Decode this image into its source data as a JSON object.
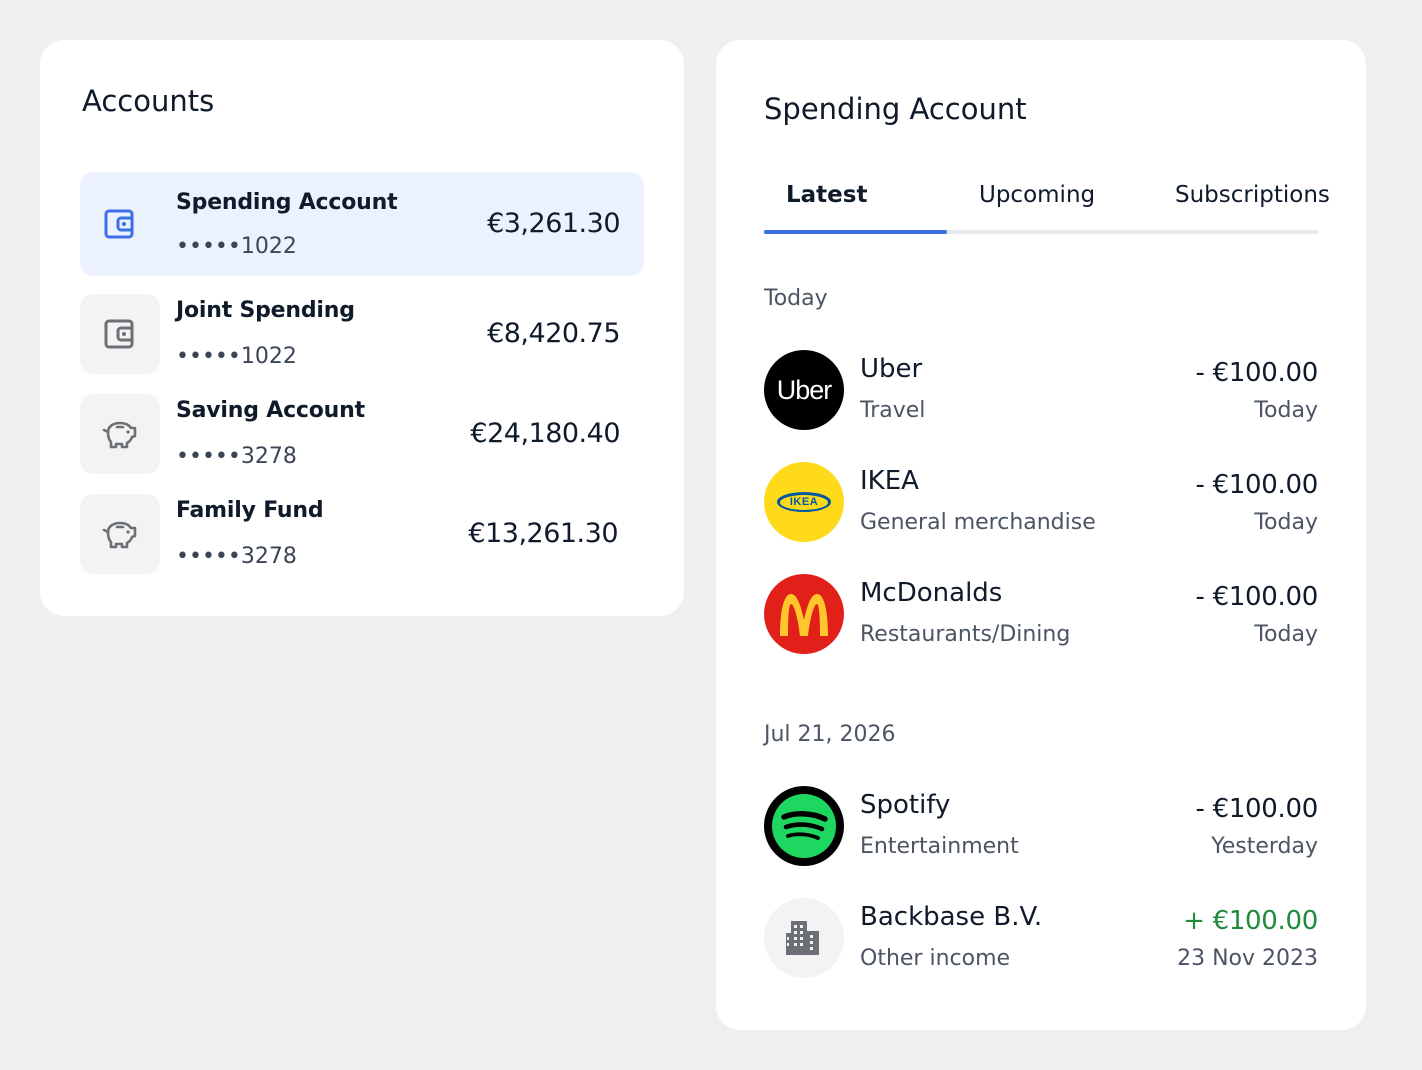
{
  "colors": {
    "accent": "#3a6fe8",
    "selected_bg": "#ebf1fd",
    "positive": "#1e8a3e",
    "uber": "#000000",
    "ikea_yellow": "#ffda1a",
    "ikea_blue": "#0058a3",
    "mcdonalds_red": "#e1201a",
    "mcdonalds_yellow": "#ffc72c",
    "spotify_green": "#1ed760"
  },
  "accounts": {
    "title": "Accounts",
    "items": [
      {
        "name": "Spending Account",
        "number": "•••••1022",
        "balance": "€3,261.30",
        "icon": "wallet-icon",
        "selected": true
      },
      {
        "name": "Joint Spending",
        "number": "•••••1022",
        "balance": "€8,420.75",
        "icon": "wallet-icon",
        "selected": false
      },
      {
        "name": "Saving Account",
        "number": "•••••3278",
        "balance": "€24,180.40",
        "icon": "piggy-bank-icon",
        "selected": false
      },
      {
        "name": "Family Fund",
        "number": "•••••3278",
        "balance": "€13,261.30",
        "icon": "piggy-bank-icon",
        "selected": false
      }
    ]
  },
  "spending": {
    "title": "Spending Account",
    "tabs": [
      {
        "label": "Latest",
        "active": true
      },
      {
        "label": "Upcoming",
        "active": false
      },
      {
        "label": "Subscriptions",
        "active": false
      }
    ],
    "groups": [
      {
        "label": "Today",
        "transactions": [
          {
            "merchant": "Uber",
            "category": "Travel",
            "amount": "- €100.00",
            "date": "Today",
            "logo": "uber-logo",
            "logo_text": "Uber"
          },
          {
            "merchant": "IKEA",
            "category": "General merchandise",
            "amount": "- €100.00",
            "date": "Today",
            "logo": "ikea-logo",
            "logo_text": "IKEA"
          },
          {
            "merchant": "McDonalds",
            "category": "Restaurants/Dining",
            "amount": "- €100.00",
            "date": "Today",
            "logo": "mcdonalds-logo"
          }
        ]
      },
      {
        "label": "Jul 21, 2026",
        "transactions": [
          {
            "merchant": "Spotify",
            "category": "Entertainment",
            "amount": "- €100.00",
            "date": "Yesterday",
            "logo": "spotify-logo"
          },
          {
            "merchant": "Backbase B.V.",
            "category": "Other income",
            "amount": "+ €100.00",
            "date": "23 Nov 2023",
            "logo": "building-icon",
            "positive": true
          }
        ]
      }
    ]
  }
}
